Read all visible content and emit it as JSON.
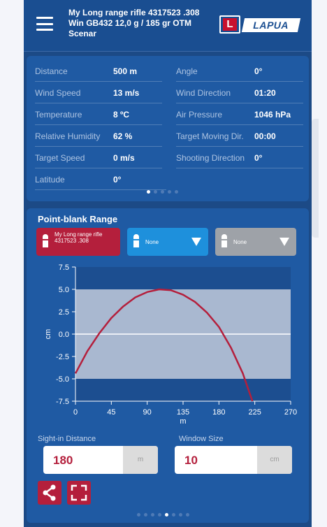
{
  "header": {
    "rifle_title": "My Long range rifle 4317523 .308 Win GB432 12,0 g / 185 gr OTM Scenar",
    "logo_text": "LAPUA",
    "logo_letter": "L"
  },
  "environment": {
    "left": [
      {
        "label": "Distance",
        "value": "500 m"
      },
      {
        "label": "Wind Speed",
        "value": "13 m/s"
      },
      {
        "label": "Temperature",
        "value": "8 ºC"
      },
      {
        "label": "Relative Humidity",
        "value": "62 %"
      },
      {
        "label": "Target Speed",
        "value": "0 m/s"
      },
      {
        "label": "Latitude",
        "value": "0°"
      }
    ],
    "right": [
      {
        "label": "Angle",
        "value": "0°"
      },
      {
        "label": "Wind Direction",
        "value": "01:20"
      },
      {
        "label": "Air Pressure",
        "value": "1046 hPa"
      },
      {
        "label": "Target Moving Dir.",
        "value": "00:00"
      },
      {
        "label": "Shooting Direction",
        "value": "0°"
      }
    ],
    "page_dots": 5,
    "active_dot": 0
  },
  "pbr": {
    "title": "Point-blank Range",
    "rifle_buttons": [
      {
        "label": "My Long range rifle 4317523 .308",
        "color": "#b41f3c"
      },
      {
        "label": "None",
        "color": "#1e90dc"
      },
      {
        "label": "None",
        "color": "#9ea2a8"
      }
    ],
    "sight_in_label": "Sight-in Distance",
    "sight_in_value": "180",
    "sight_in_unit": "m",
    "window_label": "Window Size",
    "window_value": "10",
    "window_unit": "cm",
    "page_dots": 8,
    "active_dot": 4
  },
  "chart_data": {
    "type": "line",
    "xlabel": "m",
    "ylabel": "cm",
    "xlim": [
      0,
      270
    ],
    "ylim": [
      -7.5,
      7.5
    ],
    "xticks": [
      0,
      45,
      90,
      135,
      180,
      225,
      270
    ],
    "yticks": [
      7.5,
      5.0,
      2.5,
      0.0,
      -2.5,
      -5.0,
      -7.5
    ],
    "window": {
      "ymin": -5.0,
      "ymax": 5.0
    },
    "series": [
      {
        "color": "#b41f3c",
        "x": [
          0,
          15,
          30,
          45,
          60,
          75,
          90,
          105,
          120,
          135,
          150,
          165,
          180,
          195,
          210,
          222
        ],
        "y": [
          -4.4,
          -1.9,
          0.1,
          1.8,
          3.1,
          4.1,
          4.7,
          5.0,
          4.9,
          4.4,
          3.6,
          2.4,
          0.8,
          -1.5,
          -4.4,
          -7.5
        ]
      }
    ],
    "colors": {
      "band": "#a9b8d0",
      "plot_bg": "#1c4e90",
      "axis": "#ffffff",
      "zero_line": "#ffffff"
    }
  }
}
